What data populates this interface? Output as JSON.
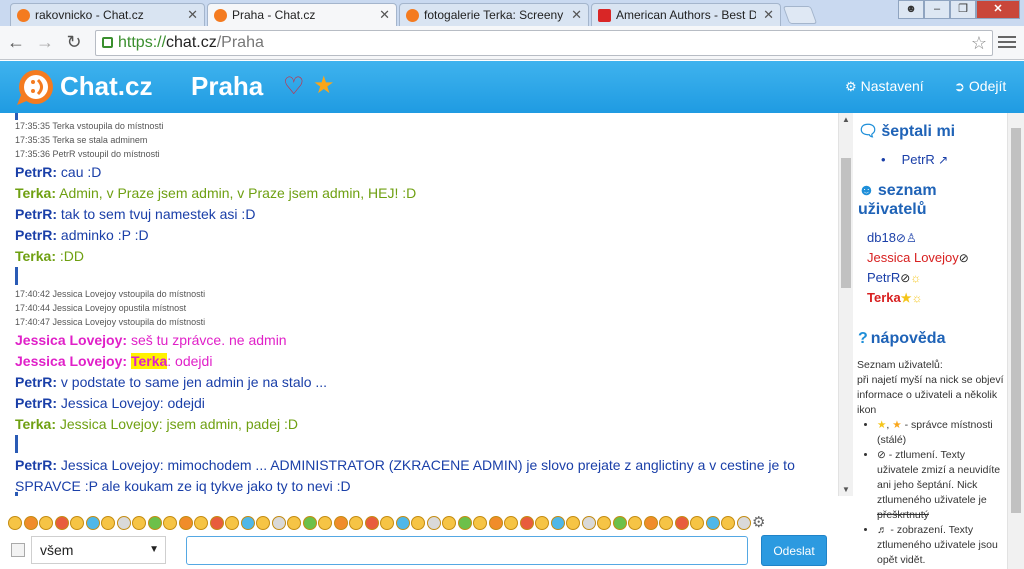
{
  "browser": {
    "tabs": [
      {
        "title": "rakovnicko - Chat.cz",
        "favicon": "chat-icon"
      },
      {
        "title": "Praha - Chat.cz",
        "favicon": "chat-icon"
      },
      {
        "title": "fotogalerie Terka: Screeny s",
        "favicon": "chat-icon"
      },
      {
        "title": "American Authors - Best D",
        "favicon": "youtube-icon"
      }
    ],
    "url": {
      "scheme": "https://",
      "host": "chat.cz",
      "path": "/Praha"
    }
  },
  "header": {
    "brand": "Chat.cz",
    "room": "Praha",
    "settings_label": "Nastavení",
    "logout_label": "Odejít",
    "colors": {
      "header_bg": "#2ea7ea",
      "heart": "#d3243a",
      "star": "#f9a61a"
    }
  },
  "messages": [
    {
      "type": "system",
      "text": "17:35:35 Terka vstoupila do místnosti"
    },
    {
      "type": "system",
      "text": "17:35:35 Terka se stala adminem"
    },
    {
      "type": "system",
      "text": "17:35:36 PetrR vstoupil do místnosti"
    },
    {
      "type": "msg",
      "nick": "PetrR:",
      "text": "cau :D"
    },
    {
      "type": "msg",
      "nick": "Terka:",
      "text": "Admin, v Praze jsem admin, v Praze jsem admin, HEJ! :D"
    },
    {
      "type": "msg",
      "nick": "PetrR:",
      "text": "tak to sem tvuj namestek asi :D"
    },
    {
      "type": "msg",
      "nick": "PetrR:",
      "text": "adminko :P :D"
    },
    {
      "type": "msg",
      "nick": "Terka:",
      "text": ":DD"
    },
    {
      "type": "system",
      "text": "17:40:42 Jessica Lovejoy vstoupila do místnosti"
    },
    {
      "type": "system",
      "text": "17:40:44 Jessica Lovejoy opustila místnost"
    },
    {
      "type": "system",
      "text": "17:40:47 Jessica Lovejoy vstoupila do místnosti"
    },
    {
      "type": "msg",
      "nick": "Jessica Lovejoy:",
      "text": "seš tu zprávce. ne admin"
    },
    {
      "type": "msg",
      "nick": "Jessica Lovejoy:",
      "highlight": "Terka",
      "text": ": odejdi"
    },
    {
      "type": "msg",
      "nick": "PetrR:",
      "text": "v podstate to same jen admin je na stalo ..."
    },
    {
      "type": "msg",
      "nick": "PetrR:",
      "text": "Jessica Lovejoy: odejdi"
    },
    {
      "type": "msg",
      "nick": "Terka:",
      "text": "Jessica Lovejoy: jsem admin, padej :D"
    },
    {
      "type": "msg",
      "nick": "PetrR:",
      "text": "Jessica Lovejoy: mimochodem ... ADMINISTRATOR (ZKRACENE ADMIN) je slovo prejate z anglictiny a v cestine je to SPRAVCE :P ale koukam ze iq tykve jako ty to nevi :D"
    }
  ],
  "nick_colors": {
    "PetrR": "#1a3fa8",
    "Terka": "#6fa012",
    "Jessica Lovejoy": "#e020c8"
  },
  "sidebar": {
    "whisper_title": "šeptali mi",
    "whispers": [
      "PetrR"
    ],
    "users_title": "seznam uživatelů",
    "users": [
      {
        "name": "db18",
        "color": "#1a3fa8"
      },
      {
        "name": "Jessica Lovejoy",
        "color": "#d82020"
      },
      {
        "name": "PetrR",
        "color": "#1a3fa8"
      },
      {
        "name": "Terka",
        "color": "#d82020"
      }
    ],
    "help_title": "nápověda",
    "help_intro": "Seznam uživatelů:",
    "help_text": "při najetí myší na nick se objeví informace o uživateli a několik ikon",
    "help_items": [
      "- správce místnosti (stálé)",
      "- ztlumení. Texty uživatele zmizí a neuvidíte ani jeho šeptání. Nick ztlumeného uživatele je",
      "přeškrtnutý",
      "- zobrazení. Texty ztlumeného uživatele jsou opět vidět."
    ]
  },
  "input": {
    "target": "všem",
    "value": "",
    "send_label": "Odeslat"
  }
}
